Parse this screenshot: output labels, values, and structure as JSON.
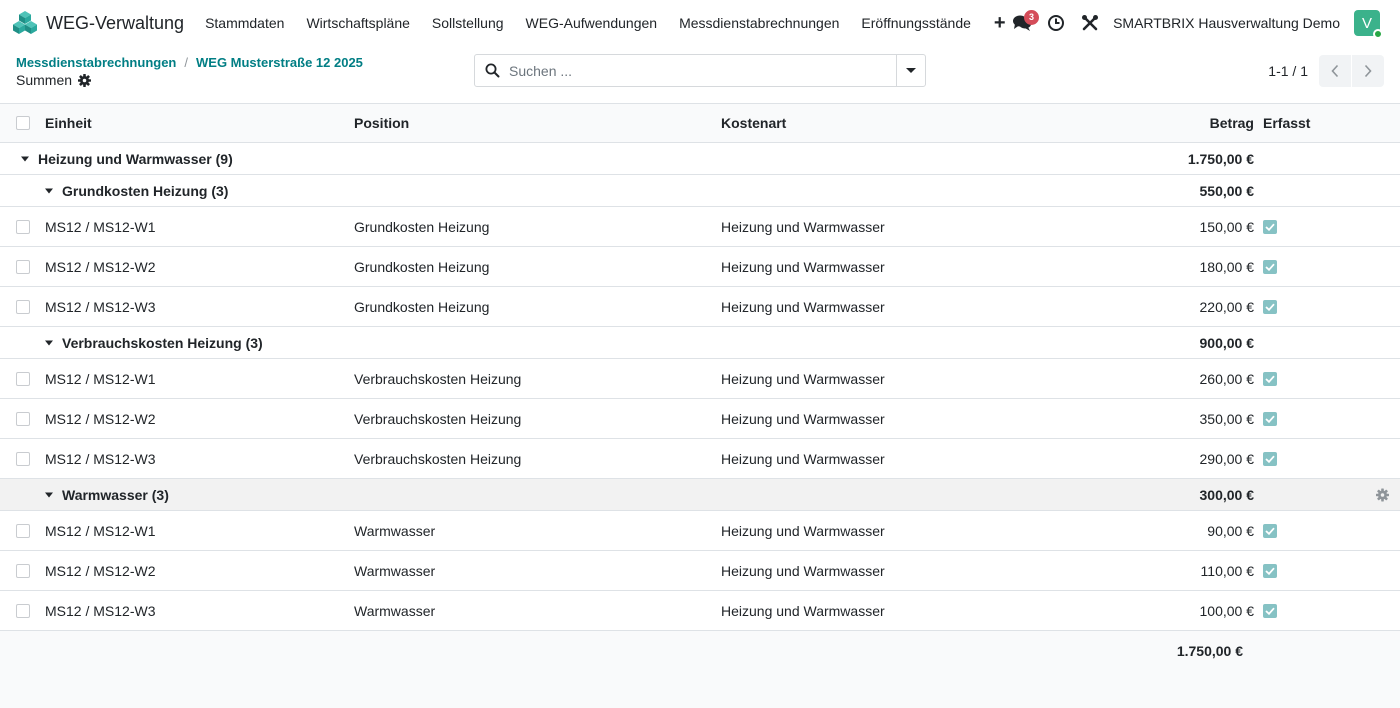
{
  "app": {
    "name": "WEG-Verwaltung"
  },
  "nav": {
    "menu": [
      "Stammdaten",
      "Wirtschaftspläne",
      "Sollstellung",
      "WEG-Aufwendungen",
      "Messdienstabrechnungen",
      "Eröffnungsstände"
    ],
    "plus": "+",
    "messages_count": "3",
    "company": "SMARTBRIX Hausverwaltung Demo",
    "avatar_letter": "V"
  },
  "breadcrumb": {
    "parent": "Messdienstabrechnungen",
    "separator": "/",
    "current": "WEG Musterstraße 12 2025"
  },
  "view_title": "Summen",
  "search": {
    "placeholder": "Suchen ..."
  },
  "pager": {
    "value": "1-1 / 1"
  },
  "table": {
    "headers": {
      "einheit": "Einheit",
      "position": "Position",
      "kostenart": "Kostenart",
      "betrag": "Betrag",
      "erfasst": "Erfasst"
    },
    "groups": [
      {
        "label": "Heizung und Warmwasser (9)",
        "total": "1.750,00 €"
      },
      {
        "label": "Grundkosten Heizung (3)",
        "total": "550,00 €"
      },
      {
        "label": "Verbrauchskosten Heizung (3)",
        "total": "900,00 €"
      },
      {
        "label": "Warmwasser (3)",
        "total": "300,00 €"
      }
    ],
    "rows": [
      {
        "einheit": "MS12 / MS12-W1",
        "position": "Grundkosten Heizung",
        "kostenart": "Heizung und Warmwasser",
        "betrag": "150,00 €"
      },
      {
        "einheit": "MS12 / MS12-W2",
        "position": "Grundkosten Heizung",
        "kostenart": "Heizung und Warmwasser",
        "betrag": "180,00 €"
      },
      {
        "einheit": "MS12 / MS12-W3",
        "position": "Grundkosten Heizung",
        "kostenart": "Heizung und Warmwasser",
        "betrag": "220,00 €"
      },
      {
        "einheit": "MS12 / MS12-W1",
        "position": "Verbrauchskosten Heizung",
        "kostenart": "Heizung und Warmwasser",
        "betrag": "260,00 €"
      },
      {
        "einheit": "MS12 / MS12-W2",
        "position": "Verbrauchskosten Heizung",
        "kostenart": "Heizung und Warmwasser",
        "betrag": "350,00 €"
      },
      {
        "einheit": "MS12 / MS12-W3",
        "position": "Verbrauchskosten Heizung",
        "kostenart": "Heizung und Warmwasser",
        "betrag": "290,00 €"
      },
      {
        "einheit": "MS12 / MS12-W1",
        "position": "Warmwasser",
        "kostenart": "Heizung und Warmwasser",
        "betrag": "90,00 €"
      },
      {
        "einheit": "MS12 / MS12-W2",
        "position": "Warmwasser",
        "kostenart": "Heizung und Warmwasser",
        "betrag": "110,00 €"
      },
      {
        "einheit": "MS12 / MS12-W3",
        "position": "Warmwasser",
        "kostenart": "Heizung und Warmwasser",
        "betrag": "100,00 €"
      }
    ],
    "footer_total": "1.750,00 €"
  },
  "icons": {
    "logo": "cube-logo-icon",
    "messages": "chat-bubbles-icon",
    "activity": "clock-icon",
    "debug": "tools-icon",
    "settings": "gear-icon",
    "search": "search-icon",
    "dropdown": "caret-down-icon",
    "prev": "chevron-left-icon",
    "next": "chevron-right-icon"
  },
  "colors": {
    "accent": "#017e84",
    "badge": "#d44c59",
    "avatar": "#3bb28b",
    "checkbox_checked": "#86c2c4"
  }
}
